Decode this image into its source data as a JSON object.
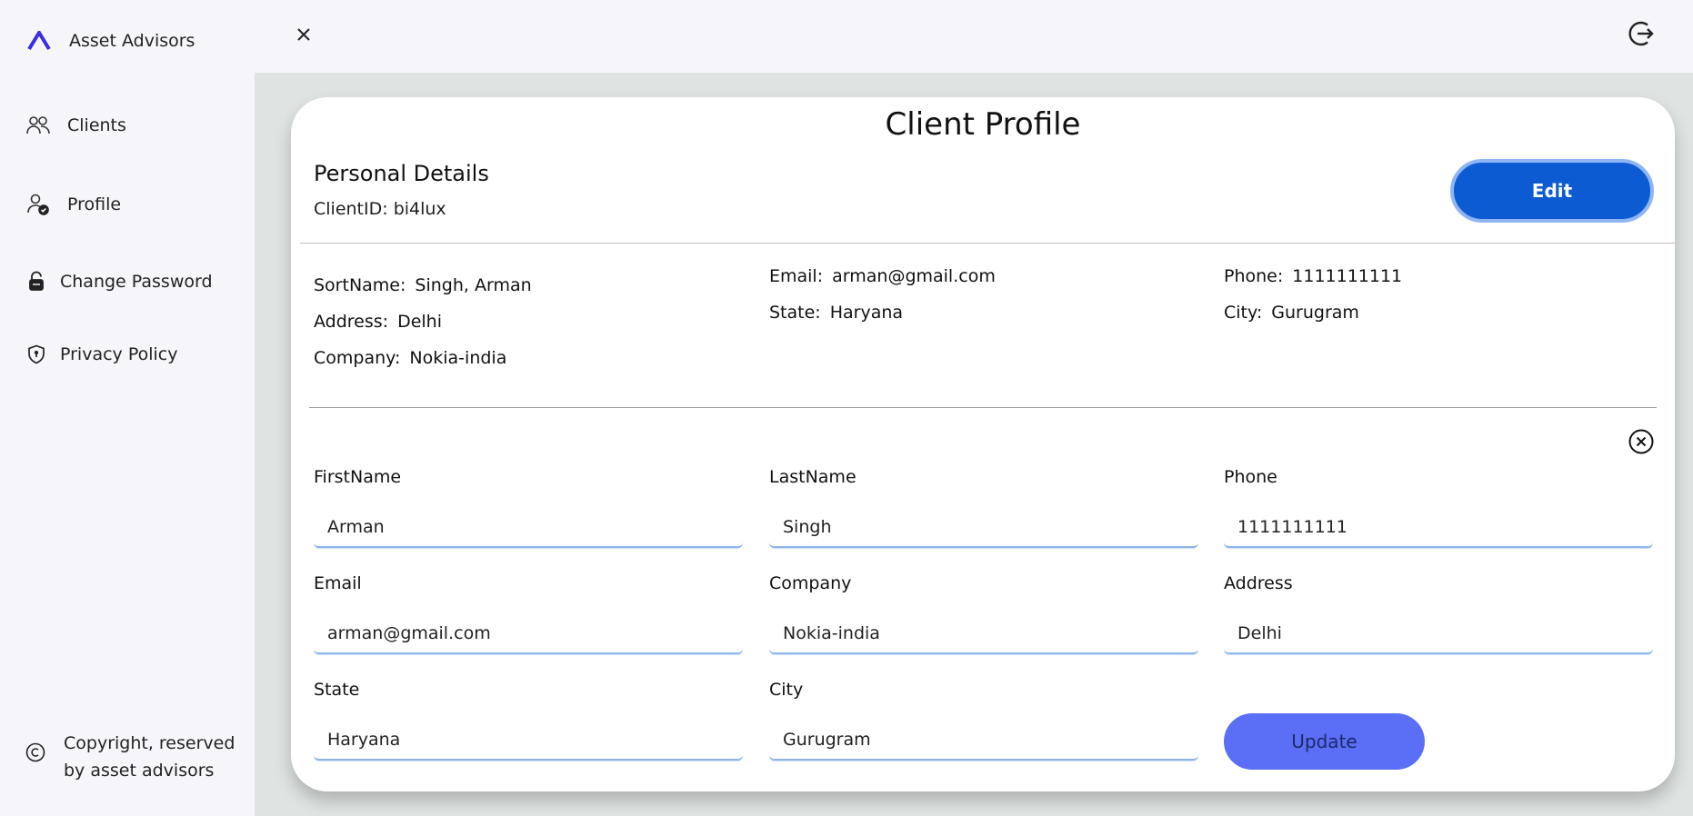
{
  "brand": {
    "name": "Asset Advisors",
    "accent": "#3b2ee0"
  },
  "sidebar": {
    "items": [
      {
        "label": "Clients",
        "icon": "users-icon"
      },
      {
        "label": "Profile",
        "icon": "user-check-icon"
      },
      {
        "label": "Change Password",
        "icon": "lock-icon"
      },
      {
        "label": "Privacy Policy",
        "icon": "shield-icon"
      }
    ],
    "footer": {
      "line1": "Copyright, reserved",
      "line2": "by asset advisors",
      "icon": "copyright-icon"
    }
  },
  "card": {
    "title": "Client Profile",
    "section_title": "Personal Details",
    "client_id_label": "ClientID:",
    "client_id": "bi4lux",
    "edit_label": "Edit"
  },
  "details": {
    "sortname": {
      "label": "SortName:",
      "value": "Singh, Arman"
    },
    "address": {
      "label": "Address:",
      "value": "Delhi"
    },
    "company": {
      "label": "Company:",
      "value": "Nokia-india"
    },
    "email": {
      "label": "Email:",
      "value": "arman@gmail.com"
    },
    "state": {
      "label": "State:",
      "value": "Haryana"
    },
    "phone": {
      "label": "Phone:",
      "value": "1111111111"
    },
    "city": {
      "label": "City:",
      "value": "Gurugram"
    }
  },
  "form": {
    "firstname": {
      "label": "FirstName",
      "value": "Arman"
    },
    "lastname": {
      "label": "LastName",
      "value": "Singh"
    },
    "phone": {
      "label": "Phone",
      "value": "1111111111"
    },
    "email": {
      "label": "Email",
      "value": "arman@gmail.com"
    },
    "company": {
      "label": "Company",
      "value": "Nokia-india"
    },
    "address": {
      "label": "Address",
      "value": "Delhi"
    },
    "state": {
      "label": "State",
      "value": "Haryana"
    },
    "city": {
      "label": "City",
      "value": "Gurugram"
    },
    "update_label": "Update"
  },
  "colors": {
    "edit_button": "#0d5bd3",
    "update_button": "#5b6ef6",
    "main_bg": "#dfe3e2",
    "sidebar_bg": "#f6f6fa"
  }
}
